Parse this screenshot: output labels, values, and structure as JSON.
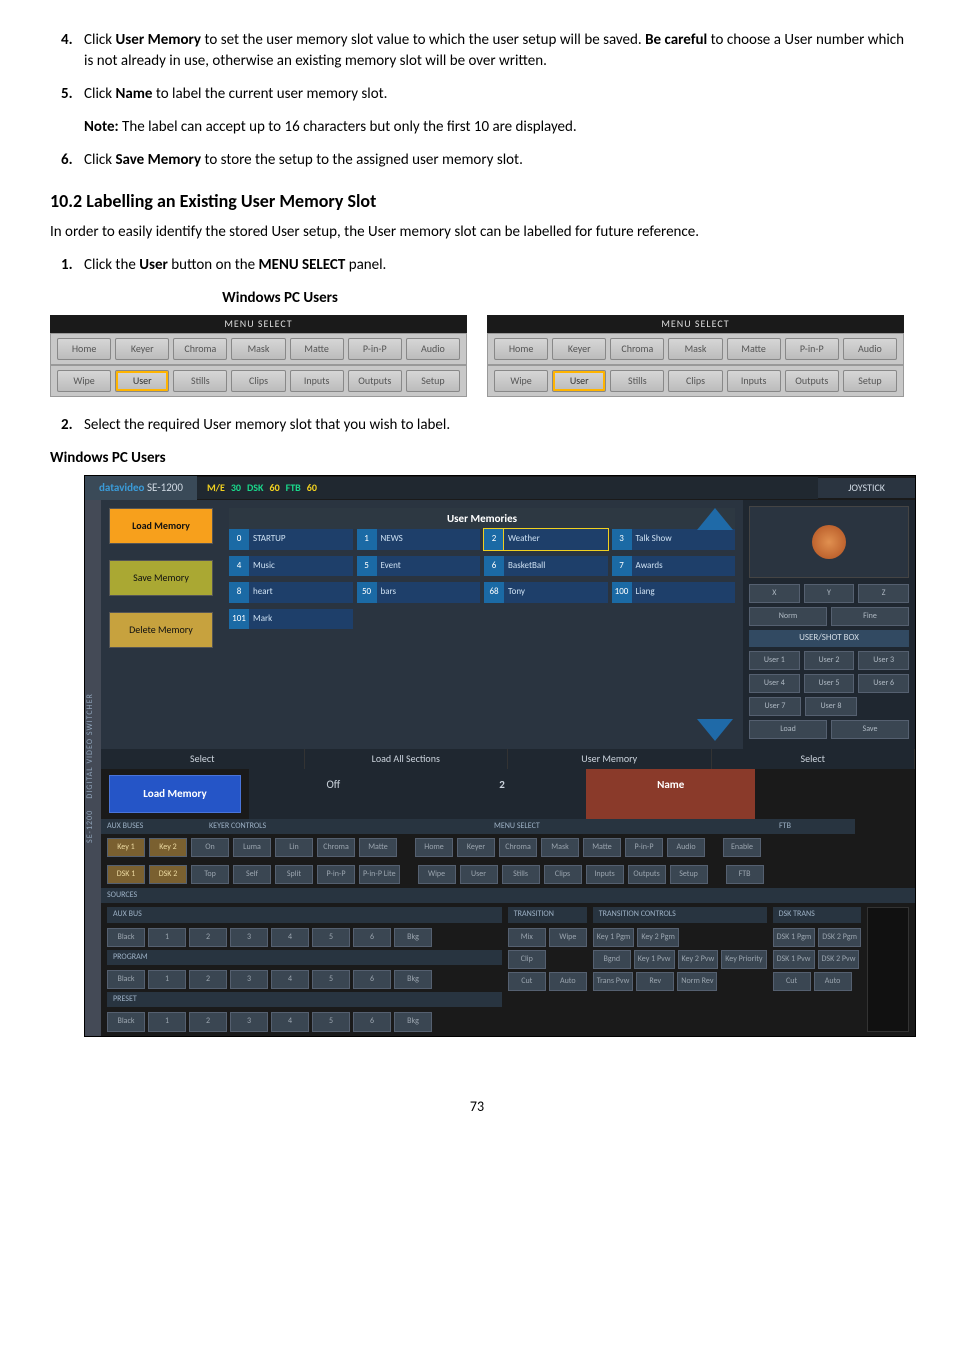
{
  "steps": {
    "s4_pre": "Click ",
    "s4_b1": "User Memory",
    "s4_mid": " to set the user memory slot value to which the user setup will be saved. ",
    "s4_b2": "Be careful",
    "s4_post": " to choose a User number which is not already in use, otherwise an existing memory slot will be over written.",
    "s5_pre": "Click ",
    "s5_b": "Name",
    "s5_post": " to label the current user memory slot.",
    "s5_note_b": "Note:",
    "s5_note": " The label can accept up to 16 characters but only the first 10 are displayed.",
    "s6_pre": "Click ",
    "s6_b": "Save Memory",
    "s6_post": " to store the setup to the assigned user memory slot."
  },
  "section_heading": "10.2   Labelling an Existing User Memory Slot",
  "section_body": "In order to easily identify the stored User setup, the User memory slot can be labelled for future reference.",
  "step1_pre": "Click the ",
  "step1_b1": "User",
  "step1_mid": " button on the ",
  "step1_b2": "MENU SELECT",
  "step1_post": " panel.",
  "panel_title": "Windows PC Users",
  "menu_select_label": "MENU SELECT",
  "menu_row1": [
    "Home",
    "Keyer",
    "Chroma",
    "Mask",
    "Matte",
    "P-in-P",
    "Audio"
  ],
  "menu_row2": [
    "Wipe",
    "User",
    "Stills",
    "Clips",
    "Inputs",
    "Outputs",
    "Setup"
  ],
  "step2_text": "Select the required User memory slot that you wish to label.",
  "sub_heading": "Windows PC Users",
  "big": {
    "brand": "datavideo",
    "model": "SE-1200",
    "status": {
      "me": "M/E",
      "me_v": "30",
      "dsk": "DSK",
      "dsk_v": "60",
      "ftb": "FTB",
      "ftb_v": "60"
    },
    "joystick": "JOYSTICK",
    "user_memories": "User Memories",
    "left": {
      "load": "Load Memory",
      "save": "Save Memory",
      "del": "Delete Memory",
      "select": "Select",
      "big": "Load Memory"
    },
    "slot_rows": [
      [
        {
          "n": "0",
          "t": "STARTUP"
        },
        {
          "n": "1",
          "t": "NEWS"
        },
        {
          "n": "2",
          "t": "Weather",
          "hl": true
        },
        {
          "n": "3",
          "t": "Talk Show"
        }
      ],
      [
        {
          "n": "4",
          "t": "Music"
        },
        {
          "n": "5",
          "t": "Event"
        },
        {
          "n": "6",
          "t": "BasketBall"
        },
        {
          "n": "7",
          "t": "Awards"
        }
      ],
      [
        {
          "n": "8",
          "t": "heart"
        },
        {
          "n": "50",
          "t": "bars"
        },
        {
          "n": "68",
          "t": "Tony"
        },
        {
          "n": "100",
          "t": "Liang"
        }
      ],
      [
        {
          "n": "101",
          "t": "Mark"
        },
        {
          "n": "",
          "t": ""
        },
        {
          "n": "",
          "t": ""
        },
        {
          "n": "",
          "t": ""
        }
      ]
    ],
    "select_row": [
      "Select",
      "Load All Sections",
      "User Memory",
      "Select"
    ],
    "action_row": {
      "off": "Off",
      "two": "2",
      "name": "Name"
    },
    "side1": "SE-1200",
    "side2": "DIGITAL VIDEO SWITCHER",
    "side3": "datavideo",
    "right": {
      "xyz": [
        "X",
        "Y",
        "Z"
      ],
      "norm": "Norm",
      "fine": "Fine",
      "usb": "USER/SHOT BOX",
      "users": [
        "User 1",
        "User 2",
        "User 3",
        "User 4",
        "User 5",
        "User 6",
        "User 7",
        "User 8"
      ],
      "ls": [
        "Load",
        "Save"
      ]
    },
    "keyer_hdr": "KEYER CONTROLS",
    "aux_buses": "AUX BUSES",
    "menu_sel": "MENU SELECT",
    "ftb_hdr": "FTB",
    "keyer_r1": [
      "Key 1",
      "Key 2",
      "On",
      "Luma",
      "Lin",
      "Chroma",
      "Matte"
    ],
    "ms_r1": [
      "Home",
      "Keyer",
      "Chroma",
      "Mask",
      "Matte",
      "P-in-P",
      "Audio"
    ],
    "keyer_r2": [
      "DSK 1",
      "DSK 2",
      "Top",
      "Self",
      "Split",
      "P-in-P",
      "P-in-P Lite"
    ],
    "ms_r2": [
      "Wipe",
      "User",
      "Stills",
      "Clips",
      "Inputs",
      "Outputs",
      "Setup"
    ],
    "ftb_r": [
      "Enable",
      "FTB"
    ],
    "sources": "SOURCES",
    "transition": "TRANSITION",
    "trans_ctrl": "TRANSITION CONTROLS",
    "dsk_trans": "DSK TRANS",
    "aux_bus": "AUX BUS",
    "program": "PROGRAM",
    "preset": "PRESET",
    "src_row": [
      "Black",
      "1",
      "2",
      "3",
      "4",
      "5",
      "6",
      "Bkg"
    ],
    "trans_row1": [
      "Mix",
      "Wipe"
    ],
    "trans_row2": [
      "Clip"
    ],
    "trans_row3": [
      "Cut",
      "Auto"
    ],
    "tc_row1": [
      "Key 1 Pgm",
      "Key 2 Pgm"
    ],
    "tc_row2": [
      "Bgnd",
      "Key 1 Pvw",
      "Key 2 Pvw",
      "Key Priority"
    ],
    "tc_row3": [
      "Trans Pvw",
      "Rev",
      "Norm Rev"
    ],
    "dsk_row1": [
      "DSK 1 Pgm",
      "DSK 2 Pgm"
    ],
    "dsk_row2": [
      "DSK 1 Pvw",
      "DSK 2 Pvw"
    ],
    "dsk_row3": [
      "Cut",
      "Auto"
    ]
  },
  "page_number": "73"
}
